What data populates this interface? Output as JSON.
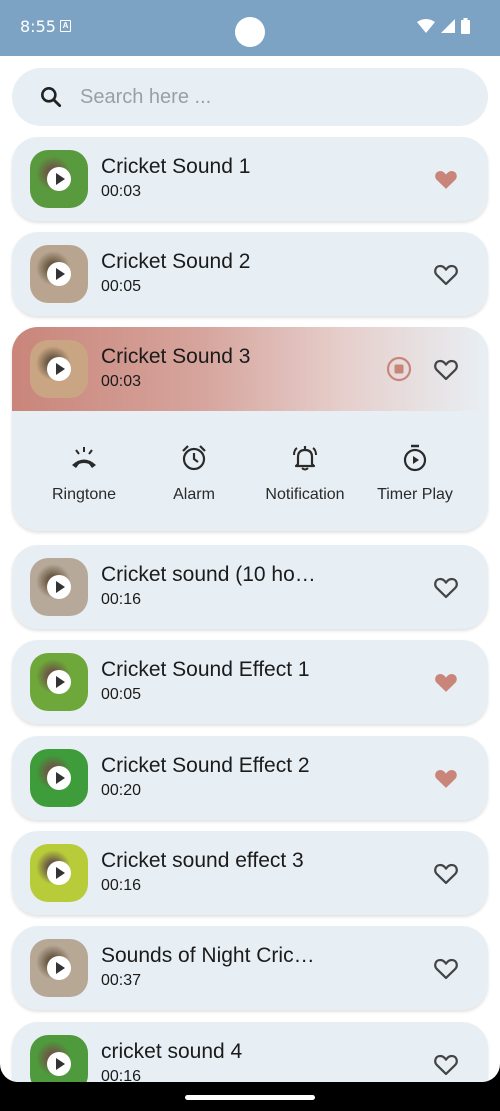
{
  "status": {
    "time": "8:55",
    "sim_glyph": "A"
  },
  "search": {
    "placeholder": "Search here ..."
  },
  "sounds": [
    {
      "title": "Cricket Sound 1",
      "duration": "00:03",
      "favorite": true,
      "thumb_color": "#5a9a3e"
    },
    {
      "title": "Cricket Sound 2",
      "duration": "00:05",
      "favorite": false,
      "thumb_color": "#b9a58f"
    },
    {
      "title": "Cricket Sound 3",
      "duration": "00:03",
      "favorite": false,
      "thumb_color": "#c9a583"
    },
    {
      "title": "Cricket sound (10 ho…",
      "duration": "00:16",
      "favorite": false,
      "thumb_color": "#b7a999"
    },
    {
      "title": "Cricket Sound Effect 1",
      "duration": "00:05",
      "favorite": true,
      "thumb_color": "#6ea83a"
    },
    {
      "title": "Cricket Sound Effect 2",
      "duration": "00:20",
      "favorite": true,
      "thumb_color": "#3f9c3a"
    },
    {
      "title": "Cricket sound effect 3",
      "duration": "00:16",
      "favorite": false,
      "thumb_color": "#b8cc3a"
    },
    {
      "title": "Sounds of Night Cric…",
      "duration": "00:37",
      "favorite": false,
      "thumb_color": "#b7a896"
    },
    {
      "title": "cricket sound 4",
      "duration": "00:16",
      "favorite": false,
      "thumb_color": "#4f9a3c"
    }
  ],
  "actions": {
    "ringtone": "Ringtone",
    "alarm": "Alarm",
    "notification": "Notification",
    "timer": "Timer Play"
  },
  "colors": {
    "accent": "#c9857a",
    "card_bg": "#e8eff4",
    "status_bar": "#7ca3c4"
  }
}
